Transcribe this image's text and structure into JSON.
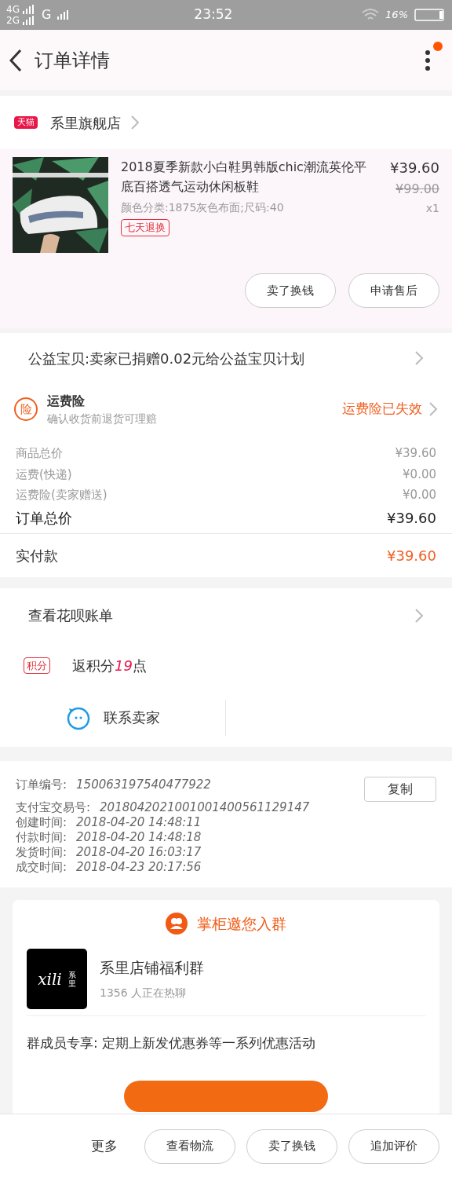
{
  "status_bar": {
    "network_1": "4G",
    "network_2": "2G",
    "network_3": "G",
    "time": "23:52",
    "battery": "16%"
  },
  "header": {
    "title": "订单详情",
    "has_notification": true
  },
  "store": {
    "badge": "天猫",
    "name": "系里旗舰店"
  },
  "product": {
    "title": "2018夏季新款小白鞋男韩版chic潮流英伦平底百搭透气运动休闲板鞋",
    "sku": "颜色分类:1875灰色布面;尺码:40",
    "tag": "七天退换",
    "price": "¥39.60",
    "original_price": "¥99.00",
    "quantity": "x1",
    "buttons": [
      "卖了换钱",
      "申请售后"
    ]
  },
  "charity": {
    "text": "公益宝贝:卖家已捐赠0.02元给公益宝贝计划"
  },
  "insurance": {
    "icon_text": "险",
    "title": "运费险",
    "subtitle": "确认收货前退货可理赔",
    "status": "运费险已失效"
  },
  "prices": [
    {
      "label": "商品总价",
      "value": "¥39.60",
      "kind": "minor"
    },
    {
      "label": "运费(快递)",
      "value": "¥0.00",
      "kind": "minor"
    },
    {
      "label": "运费险(卖家赠送)",
      "value": "¥0.00",
      "kind": "minor"
    },
    {
      "label": "订单总价",
      "value": "¥39.60",
      "kind": "total"
    }
  ],
  "paid": {
    "label": "实付款",
    "value": "¥39.60"
  },
  "huabei": {
    "text": "查看花呗账单"
  },
  "points": {
    "badge": "积分",
    "before": "返积分",
    "number": "19",
    "after": "点"
  },
  "contact": {
    "label": "联系卖家"
  },
  "order_info": {
    "copy_button": "复制",
    "rows": [
      {
        "label": "订单编号:",
        "value": "150063197540477922"
      },
      {
        "label": "支付宝交易号:",
        "value": "2018042021001001400561129147"
      },
      {
        "label": "创建时间:",
        "value": "2018-04-20 14:48:11"
      },
      {
        "label": "付款时间:",
        "value": "2018-04-20 14:48:18"
      },
      {
        "label": "发货时间:",
        "value": "2018-04-20 16:03:17"
      },
      {
        "label": "成交时间:",
        "value": "2018-04-23 20:17:56"
      }
    ]
  },
  "group": {
    "heading": "掌柜邀您入群",
    "logo_text": "xili",
    "logo_sub": "系里",
    "name": "系里店铺福利群",
    "members": "1356 人正在热聊",
    "benefit": "群成员专享: 定期上新发优惠券等一系列优惠活动"
  },
  "bottom_bar": {
    "more": "更多",
    "buttons": [
      "查看物流",
      "卖了换钱",
      "追加评价"
    ]
  }
}
